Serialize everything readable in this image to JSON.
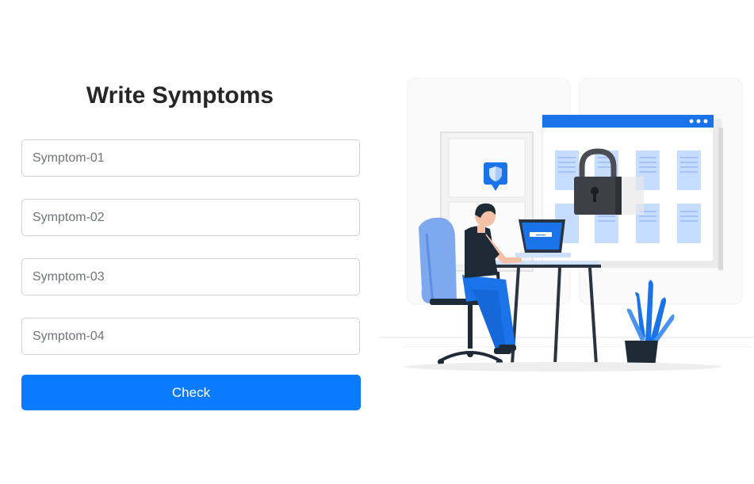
{
  "form": {
    "title": "Write Symptoms",
    "inputs": [
      {
        "placeholder": "Symptom-01",
        "value": ""
      },
      {
        "placeholder": "Symptom-02",
        "value": ""
      },
      {
        "placeholder": "Symptom-03",
        "value": ""
      },
      {
        "placeholder": "Symptom-04",
        "value": ""
      }
    ],
    "submit_label": "Check"
  },
  "illustration": {
    "icons": [
      "shield-icon",
      "padlock-icon",
      "laptop-icon",
      "plant-icon"
    ],
    "password_mask": "••••••"
  },
  "colors": {
    "accent": "#0a7bff",
    "title": "#262626",
    "input_border": "#cfd3d8",
    "illustration_blue": "#1a73e8"
  }
}
